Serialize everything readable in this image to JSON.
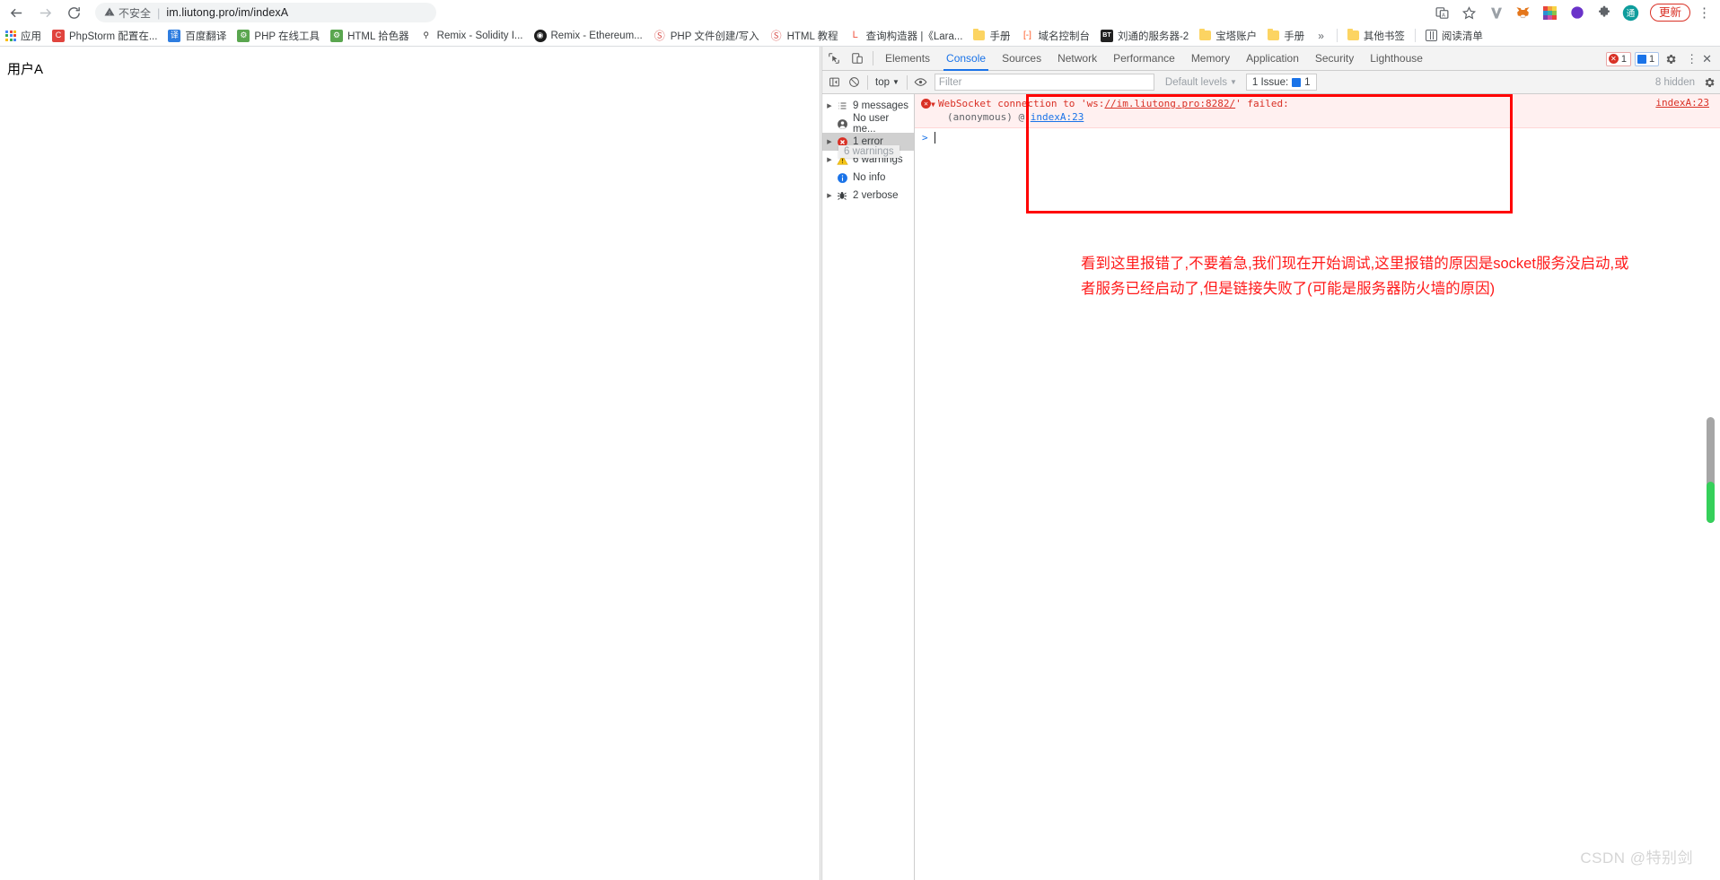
{
  "browser": {
    "back_icon": "back-arrow-icon",
    "forward_icon": "forward-arrow-icon",
    "reload_icon": "reload-icon",
    "security_label": "不安全",
    "url": "im.liutong.pro/im/indexA",
    "share_icon": "share-screencast-icon",
    "bookmark_star_icon": "star-icon",
    "update_label": "更新",
    "menu_icon": "kebab-menu-icon",
    "extensions": [
      {
        "name": "vimium-extension-icon",
        "color": "#8b8b9a",
        "glyph": "V"
      },
      {
        "name": "metamask-extension-icon",
        "color": "#f5841f",
        "glyph": "🦊"
      },
      {
        "name": "colorful-extension-icon",
        "color": "#e84a3f",
        "glyph": ""
      },
      {
        "name": "globe-extension-icon",
        "color": "#6a33c9",
        "glyph": "◐"
      },
      {
        "name": "puzzle-extensions-icon",
        "color": "#5f6368",
        "glyph": "🧩"
      },
      {
        "name": "translate-account-icon",
        "color": "#0f9d9d",
        "glyph": "通"
      }
    ]
  },
  "bookmarks": {
    "apps_label": "应用",
    "items": [
      {
        "label": "PhpStorm 配置在...",
        "icon": "phpstorm-favicon",
        "color": "#e0443e",
        "glyph": "C"
      },
      {
        "label": "百度翻译",
        "icon": "baidu-translate-favicon",
        "color": "#2e7de0",
        "glyph": "译"
      },
      {
        "label": "PHP 在线工具",
        "icon": "php-tools-favicon",
        "color": "#5aa64f",
        "glyph": "⚙"
      },
      {
        "label": "HTML 拾色器",
        "icon": "html-colorpicker-favicon",
        "color": "#5aa64f",
        "glyph": "⚙"
      },
      {
        "label": "Remix - Solidity I...",
        "icon": "remix-solidity-favicon",
        "color": "#ffffff",
        "glyph": "⚲"
      },
      {
        "label": "Remix - Ethereum...",
        "icon": "remix-ethereum-favicon",
        "color": "#1c1c1c",
        "glyph": "◉"
      },
      {
        "label": "PHP 文件创建/写入",
        "icon": "runoob-favicon",
        "color": "#d9534f",
        "glyph": "S"
      },
      {
        "label": "HTML 教程",
        "icon": "runoob-favicon",
        "color": "#d9534f",
        "glyph": "S"
      },
      {
        "label": "查询构造器 |《Lara...",
        "icon": "laravel-favicon",
        "color": "#f05340",
        "glyph": "L"
      },
      {
        "label": "手册",
        "icon": "folder-icon",
        "color": "#fcd462",
        "glyph": ""
      },
      {
        "label": "域名控制台",
        "icon": "domain-console-favicon",
        "color": "#ff5722",
        "glyph": "[-]"
      },
      {
        "label": "刘通的服务器-2",
        "icon": "bt-panel-favicon",
        "color": "#222222",
        "glyph": "BT"
      },
      {
        "label": "宝塔账户",
        "icon": "folder-icon",
        "color": "#fcd462",
        "glyph": ""
      },
      {
        "label": "手册",
        "icon": "folder-icon",
        "color": "#fcd462",
        "glyph": ""
      }
    ],
    "overflow_label": "»",
    "other_bookmarks_label": "其他书签",
    "reading_list_label": "阅读清单"
  },
  "page": {
    "user_label": "用户A"
  },
  "devtools": {
    "inspect_icon": "inspect-element-icon",
    "device_icon": "device-toolbar-icon",
    "tabs": [
      {
        "label": "Elements",
        "active": false
      },
      {
        "label": "Console",
        "active": true
      },
      {
        "label": "Sources",
        "active": false
      },
      {
        "label": "Network",
        "active": false
      },
      {
        "label": "Performance",
        "active": false
      },
      {
        "label": "Memory",
        "active": false
      },
      {
        "label": "Application",
        "active": false
      },
      {
        "label": "Security",
        "active": false
      },
      {
        "label": "Lighthouse",
        "active": false
      }
    ],
    "error_badge_count": "1",
    "message_badge_count": "1",
    "settings_icon": "gear-icon",
    "more_icon": "kebab-menu-icon",
    "close_icon": "close-icon",
    "console_toolbar": {
      "sidebar_toggle_icon": "console-sidebar-toggle-icon",
      "clear_icon": "clear-console-icon",
      "context_label": "top",
      "context_chevron": "▼",
      "eye_icon": "live-expression-eye-icon",
      "filter_placeholder": "Filter",
      "filter_value": "",
      "levels_label": "Default levels",
      "levels_chevron": "▼",
      "issues_label": "1 Issue:",
      "issues_count": "1",
      "hidden_label": "8 hidden",
      "settings_icon": "console-settings-gear-icon"
    },
    "sidebar": [
      {
        "label": "9 messages",
        "icon": "messages-list-icon",
        "arrow": true,
        "selected": false
      },
      {
        "label": "No user me...",
        "icon": "user-message-icon",
        "arrow": false,
        "selected": false
      },
      {
        "label": "1 error",
        "icon": "error-circle-icon",
        "arrow": true,
        "selected": true
      },
      {
        "label": "6 warnings",
        "icon": "warning-triangle-icon",
        "arrow": true,
        "selected": false
      },
      {
        "label": "No info",
        "icon": "info-circle-icon",
        "arrow": false,
        "selected": false
      },
      {
        "label": "2 verbose",
        "icon": "verbose-bug-icon",
        "arrow": true,
        "selected": false
      }
    ],
    "sidebar_tooltip": "6 warnings",
    "console_message": {
      "error_icon": "error-circle-icon",
      "expand_triangle": "▼",
      "line1_pre": "WebSocket connection to 'ws:",
      "line1_link": "//im.liutong.pro:8282/",
      "line1_post": "' failed:",
      "line2_pre": "(anonymous) @ ",
      "line2_link": "indexA:23",
      "source_link": "indexA:23"
    },
    "prompt": {
      "arrow": ">",
      "value": ""
    }
  },
  "annotation": {
    "line1": "看到这里报错了,不要着急,我们现在开始调试,这里报错的原因是socket服务没启动,或",
    "line2": "者服务已经启动了,但是链接失败了(可能是服务器防火墙的原因)",
    "color": "#ff1a1a"
  },
  "scrollbar": {
    "track_color": "#a6a6a6",
    "thumb_color": "#35d05a"
  },
  "watermark": "CSDN @特别剑"
}
